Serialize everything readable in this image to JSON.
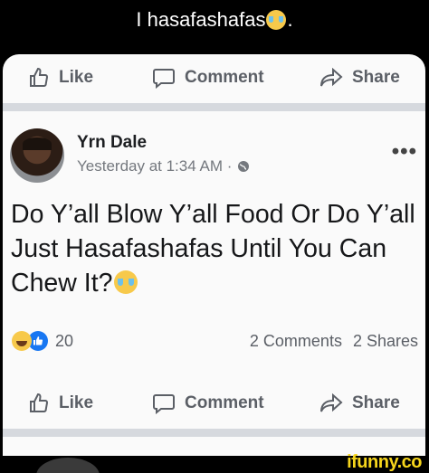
{
  "caption": {
    "text": "I hasafashafas",
    "suffix": "."
  },
  "actions": {
    "like": "Like",
    "comment": "Comment",
    "share": "Share"
  },
  "post": {
    "author": "Yrn Dale",
    "timestamp": "Yesterday at 1:34 AM · ",
    "text": "Do Y’all Blow Y’all Food Or Do Y’all Just Hasafashafas Until You Can Chew It?",
    "reaction_count": "20",
    "comments": "2 Comments",
    "shares": "2 Shares"
  },
  "watermark": "ifunny.co",
  "colors": {
    "like_blue": "#1877f2",
    "watermark_yellow": "#f6d51c",
    "divider": "#d6d9de"
  },
  "icons": [
    "crying-emoji-icon",
    "thumbs-up-icon",
    "comment-bubble-icon",
    "share-arrow-icon",
    "globe-icon",
    "more-icon",
    "haha-reaction-icon",
    "like-reaction-icon"
  ]
}
